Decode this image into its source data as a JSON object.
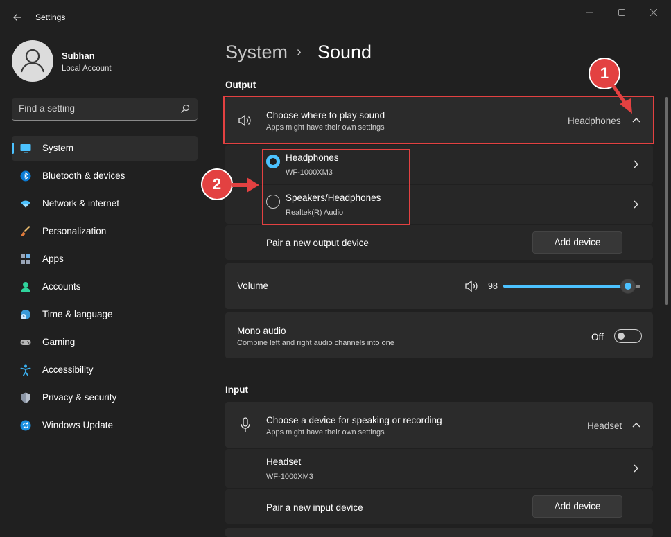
{
  "window": {
    "title": "Settings",
    "back_icon": "arrow-left-icon",
    "controls": [
      "minimize-icon",
      "maximize-icon",
      "close-icon"
    ]
  },
  "profile": {
    "name": "Subhan",
    "account_type": "Local Account"
  },
  "search": {
    "placeholder": "Find a setting",
    "value": ""
  },
  "sidebar": {
    "items": [
      {
        "label": "System",
        "icon": "monitor-icon",
        "active": true
      },
      {
        "label": "Bluetooth & devices",
        "icon": "bluetooth-icon"
      },
      {
        "label": "Network & internet",
        "icon": "wifi-icon"
      },
      {
        "label": "Personalization",
        "icon": "brush-icon"
      },
      {
        "label": "Apps",
        "icon": "apps-icon"
      },
      {
        "label": "Accounts",
        "icon": "person-icon"
      },
      {
        "label": "Time & language",
        "icon": "globe-clock-icon"
      },
      {
        "label": "Gaming",
        "icon": "gamepad-icon"
      },
      {
        "label": "Accessibility",
        "icon": "accessibility-icon"
      },
      {
        "label": "Privacy & security",
        "icon": "shield-icon"
      },
      {
        "label": "Windows Update",
        "icon": "update-icon"
      }
    ]
  },
  "header": {
    "parent": "System",
    "separator": "›",
    "current": "Sound"
  },
  "output": {
    "section_label": "Output",
    "choose": {
      "title": "Choose where to play sound",
      "subtitle": "Apps might have their own settings",
      "value": "Headphones"
    },
    "devices": [
      {
        "name": "Headphones",
        "detail": "WF-1000XM3",
        "selected": true
      },
      {
        "name": "Speakers/Headphones",
        "detail": "Realtek(R) Audio",
        "selected": false
      }
    ],
    "pair": {
      "label": "Pair a new output device",
      "button": "Add device"
    }
  },
  "volume": {
    "label": "Volume",
    "value": "98",
    "level": 98
  },
  "mono": {
    "title": "Mono audio",
    "subtitle": "Combine left and right audio channels into one",
    "state": "Off"
  },
  "input": {
    "section_label": "Input",
    "choose": {
      "title": "Choose a device for speaking or recording",
      "subtitle": "Apps might have their own settings",
      "value": "Headset"
    },
    "devices": [
      {
        "name": "Headset",
        "detail": "WF-1000XM3"
      }
    ],
    "pair": {
      "label": "Pair a new input device",
      "button": "Add device"
    }
  },
  "annotations": {
    "step1": "1",
    "step2": "2",
    "color": "#e34141"
  },
  "colors": {
    "accent": "#4cc2ff",
    "background": "#202020",
    "card": "#2b2b2b"
  }
}
